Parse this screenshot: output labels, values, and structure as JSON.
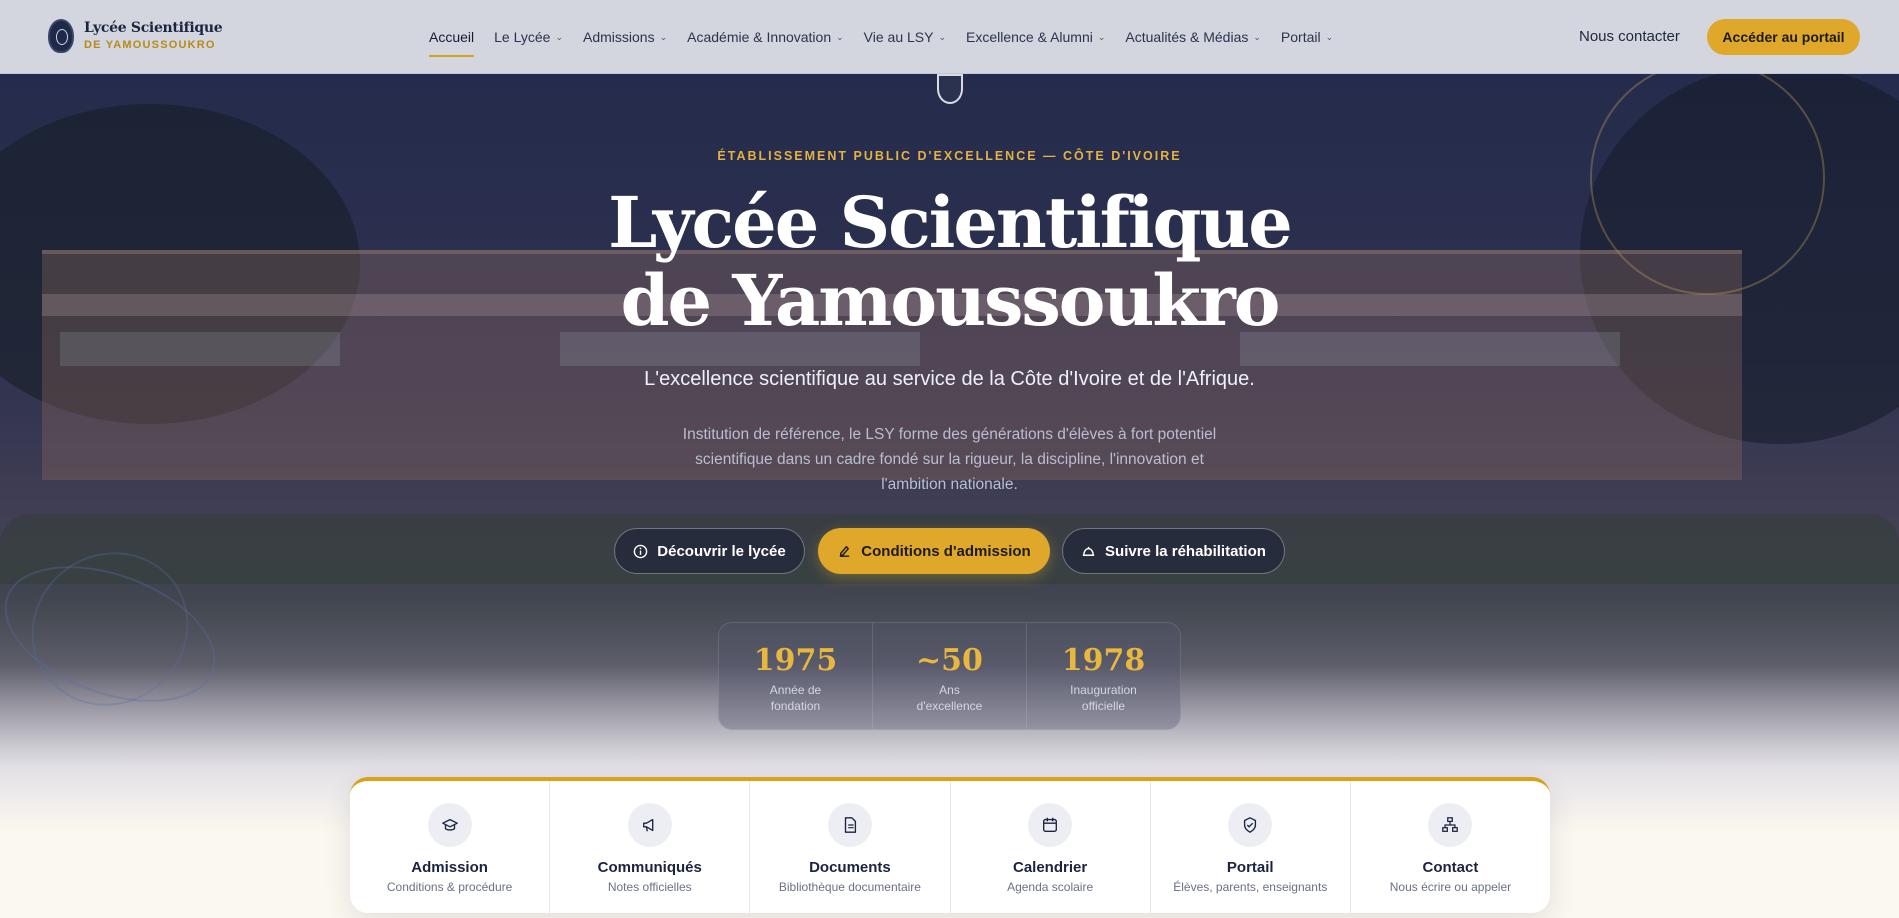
{
  "brand": {
    "name": "Lycée Scientifique",
    "sub": "DE YAMOUSSOUKRO"
  },
  "nav": [
    {
      "label": "Accueil",
      "active": true,
      "dropdown": false
    },
    {
      "label": "Le Lycée",
      "dropdown": true
    },
    {
      "label": "Admissions",
      "dropdown": true
    },
    {
      "label": "Académie & Innovation",
      "dropdown": true
    },
    {
      "label": "Vie au LSY",
      "dropdown": true
    },
    {
      "label": "Excellence & Alumni",
      "dropdown": true
    },
    {
      "label": "Actualités & Médias",
      "dropdown": true
    },
    {
      "label": "Portail",
      "dropdown": true
    }
  ],
  "header": {
    "contact": "Nous contacter",
    "portal_button": "Accéder au portail"
  },
  "hero": {
    "kicker": "ÉTABLISSEMENT PUBLIC D'EXCELLENCE — CÔTE D'IVOIRE",
    "title_line1": "Lycée Scientifique",
    "title_line2": "de Yamoussoukro",
    "tagline": "L'excellence scientifique au service de la Côte d'Ivoire et de l'Afrique.",
    "description": "Institution de référence, le LSY forme des générations d'élèves à fort potentiel scientifique dans un cadre fondé sur la rigueur, la discipline, l'innovation et l'ambition nationale.",
    "buttons": {
      "discover": "Découvrir le lycée",
      "admission": "Conditions d'admission",
      "rehab": "Suivre la réhabilitation"
    }
  },
  "stats": [
    {
      "value": "1975",
      "label": "Année de fondation"
    },
    {
      "value": "~50",
      "label": "Ans d'excellence"
    },
    {
      "value": "1978",
      "label": "Inauguration officielle"
    }
  ],
  "quick_links": [
    {
      "title": "Admission",
      "sub": "Conditions & procédure",
      "icon": "graduation-cap-icon"
    },
    {
      "title": "Communiqués",
      "sub": "Notes officielles",
      "icon": "megaphone-icon"
    },
    {
      "title": "Documents",
      "sub": "Bibliothèque documentaire",
      "icon": "document-icon"
    },
    {
      "title": "Calendrier",
      "sub": "Agenda scolaire",
      "icon": "calendar-icon"
    },
    {
      "title": "Portail",
      "sub": "Élèves, parents, enseignants",
      "icon": "shield-check-icon"
    },
    {
      "title": "Contact",
      "sub": "Nous écrire ou appeler",
      "icon": "network-icon"
    }
  ],
  "colors": {
    "gold": "#e0a82a",
    "navy": "#1c2540",
    "header_bg": "#d3d6de"
  }
}
